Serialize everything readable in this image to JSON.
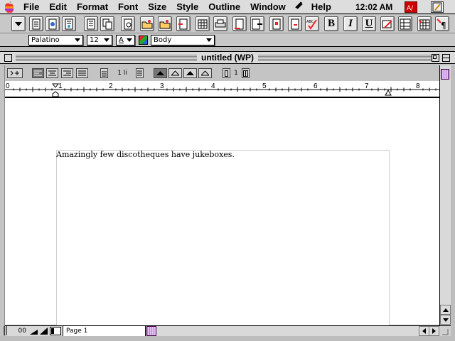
{
  "menubar": {
    "items": [
      "File",
      "Edit",
      "Format",
      "Font",
      "Size",
      "Style",
      "Outline",
      "Window",
      "Help"
    ],
    "clock": "12:02 AM",
    "icons": [
      "apple-icon",
      "help-balloon-icon",
      "appleworks-app-icon",
      "notepad-icon"
    ]
  },
  "toolbar": {
    "buttons": [
      "menu-popup",
      "new-document",
      "open-document",
      "save-document",
      "insert-page",
      "copy",
      "print-preview",
      "open-folder",
      "new-folder",
      "insert-file",
      "table",
      "print",
      "mail",
      "mail-merge",
      "spell-check",
      "bold",
      "italic",
      "underline",
      "thesaurus",
      "insert-table",
      "insert-spreadsheet",
      "paragraph-marks"
    ],
    "bold_label": "B",
    "italic_label": "I",
    "underline_label": "U"
  },
  "format_bar": {
    "font": "Palatino",
    "size": "12",
    "text_color": "A",
    "style": "Body"
  },
  "window": {
    "title": "untitled (WP)"
  },
  "ruler_tools": {
    "line_spacing": "1 li",
    "columns": "1"
  },
  "ruler": {
    "marks": [
      "0",
      "1",
      "2",
      "3",
      "4",
      "5",
      "6",
      "7",
      "8"
    ]
  },
  "document": {
    "text": "Amazingly few discotheques have jukeboxes."
  },
  "status": {
    "zoom": "00",
    "page": "Page 1"
  }
}
